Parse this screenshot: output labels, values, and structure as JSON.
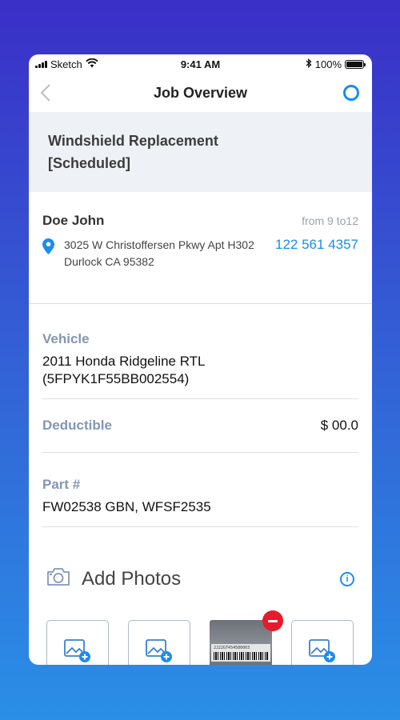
{
  "status_bar": {
    "carrier": "Sketch",
    "time": "9:41 AM",
    "battery": "100%",
    "battery_level": 1.0
  },
  "nav": {
    "title": "Job Overview",
    "back_icon": "chevron-left-icon",
    "status_icon": "status-ring-icon"
  },
  "job": {
    "title": "Windshield Replacement\n[Scheduled]"
  },
  "customer": {
    "name": "Doe John",
    "time_window": "from 9 to12",
    "address": "3025 W Christoffersen Pkwy Apt H302 Durlock CA 95382",
    "phone": "122 561 4357",
    "location_icon": "map-pin-icon"
  },
  "vehicle": {
    "label": "Vehicle",
    "value": "2011 Honda Ridgeline RTL (5FPYK1F55BB002554)"
  },
  "deductible": {
    "label": "Deductible",
    "value": "$ 00.0"
  },
  "part": {
    "label": "Part #",
    "value": "FW02538 GBN, WFSF2535"
  },
  "photos": {
    "title": "Add Photos",
    "camera_icon": "camera-icon",
    "info_icon": "info-icon",
    "barcode_text": "2J22GT454580003"
  },
  "colors": {
    "accent": "#1a8cf0",
    "label": "#8596b2",
    "remove": "#e8192c",
    "banner_bg": "#eef1f5"
  }
}
